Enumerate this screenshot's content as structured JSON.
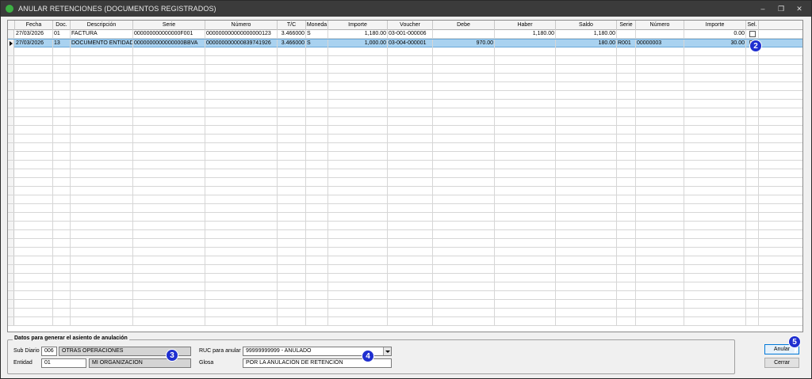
{
  "window": {
    "title": "ANULAR RETENCIONES (DOCUMENTOS REGISTRADOS)",
    "min_glyph": "–",
    "max_glyph": "❐",
    "close_glyph": "✕"
  },
  "grid": {
    "columns": [
      "Fecha",
      "Doc.",
      "Descripción",
      "Serie",
      "Número",
      "T/C",
      "Moneda",
      "Importe",
      "Voucher",
      "Debe",
      "Haber",
      "Saldo",
      "Serie",
      "Número",
      "Importe",
      "Sel."
    ],
    "rows": [
      {
        "fecha": "27/03/2026",
        "doc": "01",
        "descripcion": "FACTURA",
        "serie": "000000000000000F001",
        "numero": "000000000000000000123",
        "tc": "3.466000",
        "moneda": "S",
        "importe": "1,180.00",
        "voucher": "03-001-000006",
        "debe": "",
        "haber": "1,180.00",
        "saldo": "1,180.00",
        "serie2": "",
        "numero2": "",
        "importe2": "0.00",
        "selected": false
      },
      {
        "fecha": "27/03/2026",
        "doc": "13",
        "descripcion": "DOCUMENTO ENTIDADE:",
        "serie": "0000000000000000BBVA",
        "numero": "000000000000839741926",
        "tc": "3.466000",
        "moneda": "S",
        "importe": "1,000.00",
        "voucher": "03-004-000001",
        "debe": "970.00",
        "haber": "",
        "saldo": "180.00",
        "serie2": "R001",
        "numero2": "00000003",
        "importe2": "30.00",
        "selected": true
      }
    ]
  },
  "form": {
    "group_title": "Datos para generar el asiento de anulación",
    "sub_diario_label": "Sub Diario",
    "sub_diario_code": "006",
    "sub_diario_name": "OTRAS OPERACIONES",
    "entidad_label": "Entidad",
    "entidad_code": "01",
    "entidad_name": "MI ORGANIZACION",
    "ruc_label": "RUC para anular",
    "ruc_value": "99999999999 - ANULADO",
    "glosa_label": "Glosa",
    "glosa_value": "POR LA ANULACIÓN DE RETENCIÓN"
  },
  "buttons": {
    "anular": "Anular",
    "cerrar": "Cerrar"
  },
  "badges": {
    "b2": "2",
    "b3": "3",
    "b4": "4",
    "b5": "5"
  }
}
